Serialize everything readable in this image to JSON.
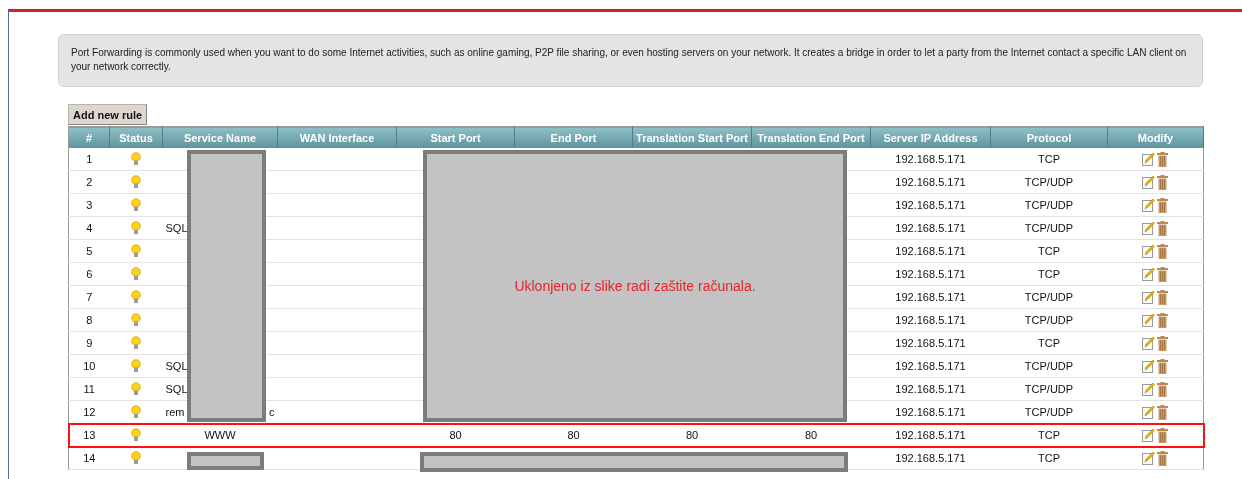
{
  "intro": "Port Forwarding is commonly used when you want to do some Internet activities, such as online gaming, P2P file sharing, or even hosting servers on your network. It creates a bridge in order to let a party from the Internet contact a specific LAN client on your network correctly.",
  "add_button": "Add new rule",
  "columns": [
    "#",
    "Status",
    "Service Name",
    "WAN Interface",
    "Start Port",
    "End Port",
    "Translation Start Port",
    "Translation End Port",
    "Server IP Address",
    "Protocol",
    "Modify"
  ],
  "rules": [
    {
      "number": "1",
      "server_ip": "192.168.5.171",
      "protocol": "TCP",
      "highlighted": false
    },
    {
      "number": "2",
      "server_ip": "192.168.5.171",
      "protocol": "TCP/UDP",
      "highlighted": false
    },
    {
      "number": "3",
      "server_ip": "192.168.5.171",
      "protocol": "TCP/UDP",
      "highlighted": false
    },
    {
      "number": "4",
      "service_name": "SQL",
      "server_ip": "192.168.5.171",
      "protocol": "TCP/UDP",
      "highlighted": false
    },
    {
      "number": "5",
      "server_ip": "192.168.5.171",
      "protocol": "TCP",
      "highlighted": false
    },
    {
      "number": "6",
      "server_ip": "192.168.5.171",
      "protocol": "TCP",
      "highlighted": false
    },
    {
      "number": "7",
      "server_ip": "192.168.5.171",
      "protocol": "TCP/UDP",
      "highlighted": false
    },
    {
      "number": "8",
      "server_ip": "192.168.5.171",
      "protocol": "TCP/UDP",
      "highlighted": false
    },
    {
      "number": "9",
      "server_ip": "192.168.5.171",
      "protocol": "TCP",
      "highlighted": false
    },
    {
      "number": "10",
      "service_name": "SQL",
      "server_ip": "192.168.5.171",
      "protocol": "TCP/UDP",
      "highlighted": false
    },
    {
      "number": "11",
      "service_name": "SQL",
      "server_ip": "192.168.5.171",
      "protocol": "TCP/UDP",
      "highlighted": false
    },
    {
      "number": "12",
      "service_name": "rem",
      "service_name_end": "c",
      "server_ip": "192.168.5.171",
      "protocol": "TCP/UDP",
      "highlighted": false
    },
    {
      "number": "13",
      "service_name": "WWW",
      "start_port": "80",
      "end_port": "80",
      "translation_start_port": "80",
      "translation_end_port": "80",
      "server_ip": "192.168.5.171",
      "protocol": "TCP",
      "highlighted": true
    },
    {
      "number": "14",
      "server_ip": "192.168.5.171",
      "protocol": "TCP",
      "highlighted": false
    }
  ],
  "redaction_note": "Uklonjeno iz slike radi zaštite računala."
}
